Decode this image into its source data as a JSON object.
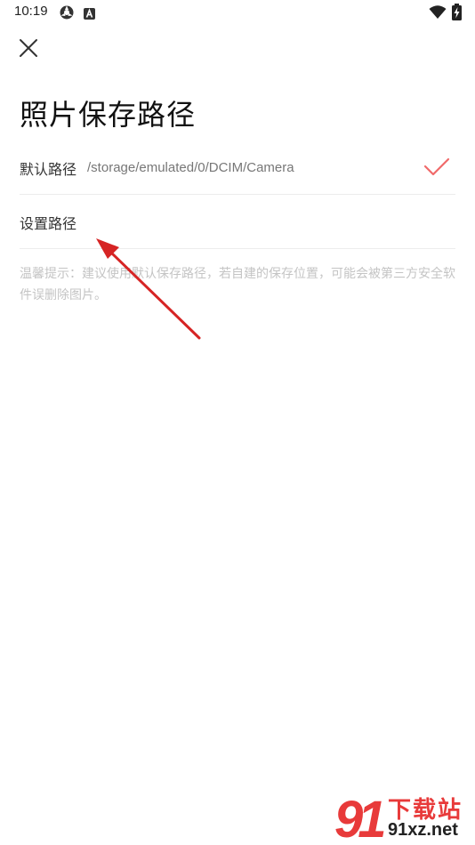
{
  "status_bar": {
    "time": "10:19",
    "icons": [
      "sync-icon",
      "a-badge-icon",
      "wifi-icon",
      "battery-charging-icon"
    ]
  },
  "header": {
    "close_icon": "close-icon",
    "title": "照片保存路径"
  },
  "options": {
    "default": {
      "label": "默认路径",
      "path": "/storage/emulated/0/DCIM/Camera",
      "selected": true
    },
    "custom": {
      "label": "设置路径"
    }
  },
  "tip": "温馨提示：建议使用默认保存路径，若自建的保存位置，可能会被第三方安全软件误删除图片。",
  "watermark": {
    "number": "91",
    "brand": "下载站",
    "site": "91xz.net"
  },
  "colors": {
    "accent": "#f06a6a",
    "arrow": "#d62424",
    "tip_text": "#c4c4c4",
    "divider": "#ececec"
  }
}
